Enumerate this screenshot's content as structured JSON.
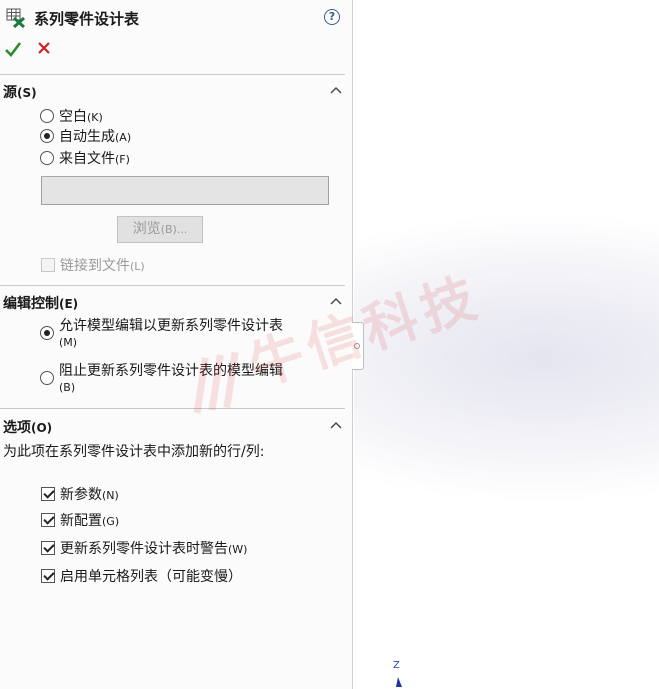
{
  "title": "系列零件设计表",
  "help": "?",
  "source": {
    "section_title": "源",
    "section_key": "(S)",
    "options": [
      {
        "label": "空白",
        "key": "(K)",
        "checked": false
      },
      {
        "label": "自动生成",
        "key": "(A)",
        "checked": true
      },
      {
        "label": "来自文件",
        "key": "(F)",
        "checked": false
      }
    ],
    "file_value": "",
    "browse_label": "浏览",
    "browse_key": "(B)...",
    "link_label": "链接到文件",
    "link_key": "(L)"
  },
  "edit_control": {
    "section_title": "编辑控制",
    "section_key": "(E)",
    "options": [
      {
        "label": "允许模型编辑以更新系列零件设计表",
        "key": "(M)",
        "checked": true
      },
      {
        "label": "阻止更新系列零件设计表的模型编辑",
        "key": "(B)",
        "checked": false
      }
    ]
  },
  "options": {
    "section_title": "选项",
    "section_key": "(O)",
    "description": "为此项在系列零件设计表中添加新的行/列:",
    "items": [
      {
        "label": "新参数",
        "key": "(N)",
        "checked": true
      },
      {
        "label": "新配置",
        "key": "(G)",
        "checked": true
      },
      {
        "label": "更新系列零件设计表时警告",
        "key": "(W)",
        "checked": true
      },
      {
        "label": "启用单元格列表（可能变慢）",
        "key": "",
        "checked": true
      }
    ]
  },
  "viewport": {
    "axis_label": "Z",
    "watermark": "牛信科技"
  },
  "colors": {
    "ok": "#2e8b2e",
    "cancel": "#cc2222",
    "accent": "#3a5d8f"
  }
}
